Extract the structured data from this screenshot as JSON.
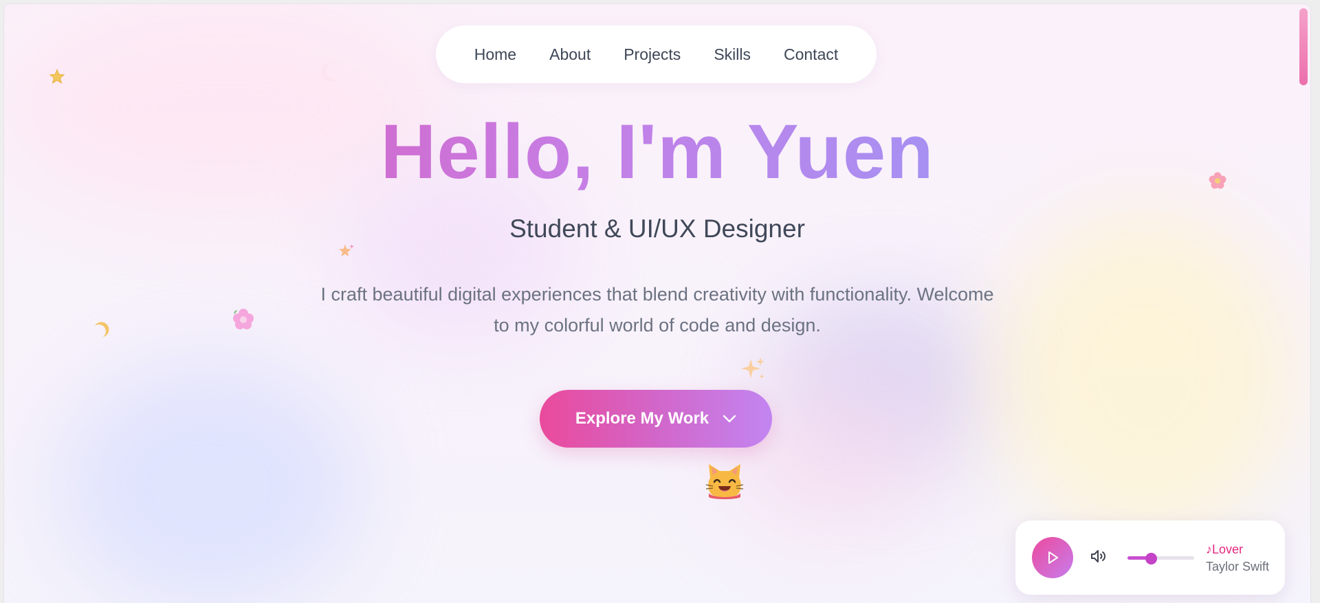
{
  "nav": {
    "items": [
      "Home",
      "About",
      "Projects",
      "Skills",
      "Contact"
    ]
  },
  "hero": {
    "title": "Hello, I'm Yuen",
    "subtitle": "Student & UI/UX Designer",
    "description": "I craft beautiful digital experiences that blend creativity with functionality. Welcome to my colorful world of code and design.",
    "cta_label": "Explore My Work"
  },
  "music_player": {
    "track_title": "Lover",
    "track_prefix": "♪",
    "artist": "Taylor Swift",
    "volume_level": 0.35,
    "icons": [
      "play-icon",
      "volume-icon"
    ]
  },
  "decorations": [
    "star-icon",
    "sparkle-icon",
    "flower-icon",
    "moon-icon",
    "cat-icon"
  ],
  "colors": {
    "accent_pink": "#e14fae",
    "accent_purple": "#c285f1",
    "accent_blue": "#86a7f5",
    "track_title": "#e3287f"
  }
}
